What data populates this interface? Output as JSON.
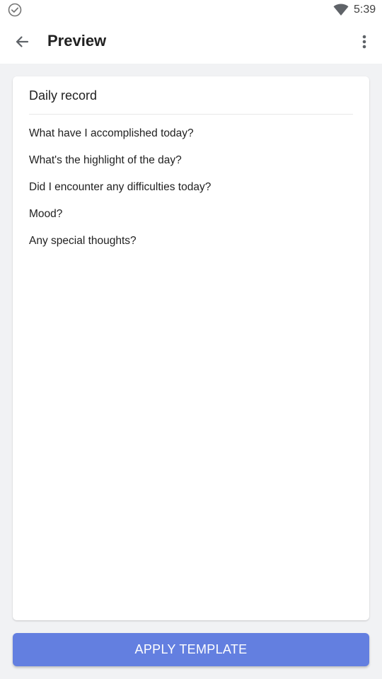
{
  "status_bar": {
    "time": "5:39",
    "icons": [
      "check-circle-icon",
      "wifi-icon"
    ]
  },
  "app_bar": {
    "title": "Preview",
    "back_icon": "arrow-back-icon",
    "menu_icon": "more-vert-icon"
  },
  "template": {
    "title": "Daily record",
    "questions": [
      "What have I accomplished today?",
      "What's the highlight of the day?",
      "Did I encounter any difficulties today?",
      "Mood?",
      "Any special thoughts?"
    ]
  },
  "actions": {
    "apply_label": "APPLY TEMPLATE",
    "accent_color": "#637fe0"
  }
}
